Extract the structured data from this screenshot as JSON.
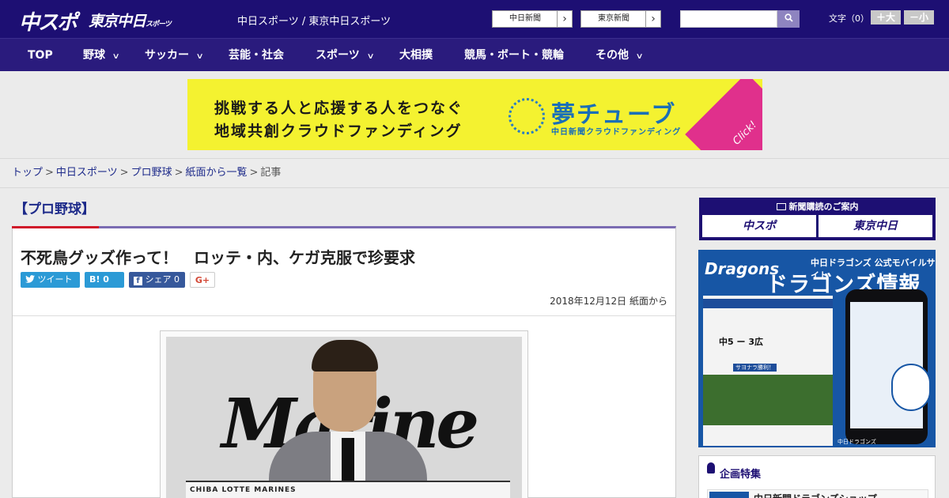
{
  "header": {
    "logo_chuspo": "中スポ",
    "logo_tokyo": "東京中日",
    "logo_tokyo_suffix": "スポーツ",
    "site_title": "中日スポーツ / 東京中日スポーツ",
    "links": [
      {
        "label": "中日新聞",
        "arrow": "›"
      },
      {
        "label": "東京新聞",
        "arrow": "›"
      }
    ],
    "search": {
      "placeholder": "",
      "button_icon": "search-icon"
    },
    "font_size": {
      "label": "文字（0）",
      "larger": "＋大",
      "smaller": "－小"
    }
  },
  "nav": [
    {
      "label": "TOP",
      "dropdown": false
    },
    {
      "label": "野球",
      "dropdown": true
    },
    {
      "label": "サッカー",
      "dropdown": true
    },
    {
      "label": "芸能・社会",
      "dropdown": false
    },
    {
      "label": "スポーツ",
      "dropdown": true
    },
    {
      "label": "大相撲",
      "dropdown": false
    },
    {
      "label": "競馬・ボート・競輪",
      "dropdown": false
    },
    {
      "label": "その他",
      "dropdown": true
    }
  ],
  "nav_chevron": "∨",
  "banner": {
    "line1": "挑戦する人と応援する人をつなぐ",
    "line2": "地域共創クラウドファンディング",
    "brand": "夢チューブ",
    "brand_sub": "中日新聞クラウドファンディング",
    "click": "Click!",
    "bg_color": "#f4f230"
  },
  "breadcrumb": {
    "items": [
      "トップ",
      "中日スポーツ",
      "プロ野球",
      "紙面から一覧"
    ],
    "current": "記事",
    "separator": ">"
  },
  "article": {
    "category": "【プロ野球】",
    "headline": "不死鳥グッズ作って！　ロッテ・内、ケガ克服で珍要求",
    "share": {
      "tweet": "ツイート",
      "hatena": "B! 0",
      "facebook": "シェア 0",
      "gplus": "G+"
    },
    "dateline": "2018年12月12日 紙面から",
    "photo": {
      "backdrop_text": "Marine",
      "towel_text": "CHIBA LOTTE MARINES"
    }
  },
  "sidebar": {
    "subscription": {
      "title": "新聞購読のご案内",
      "buttons": [
        "中スポ",
        "東京中日"
      ]
    },
    "dragons_ad": {
      "logo": "Dragons",
      "subtitle": "中日ドラゴンズ 公式モバイルサイト",
      "title": "ドラゴンズ情報",
      "score": "中5 ー 3広",
      "headline": "サヨナラ勝利！",
      "footer": "中日ドラゴンズ"
    },
    "plan": {
      "title": "企画特集",
      "items": [
        "中日新聞ドラゴンズショップ"
      ]
    }
  },
  "colors": {
    "header_bg": "#1d0f73",
    "nav_bg": "#2a1b7d",
    "accent_red": "#d0182a",
    "accent_purple": "#7b6cb2",
    "link": "#1d2a8a"
  }
}
